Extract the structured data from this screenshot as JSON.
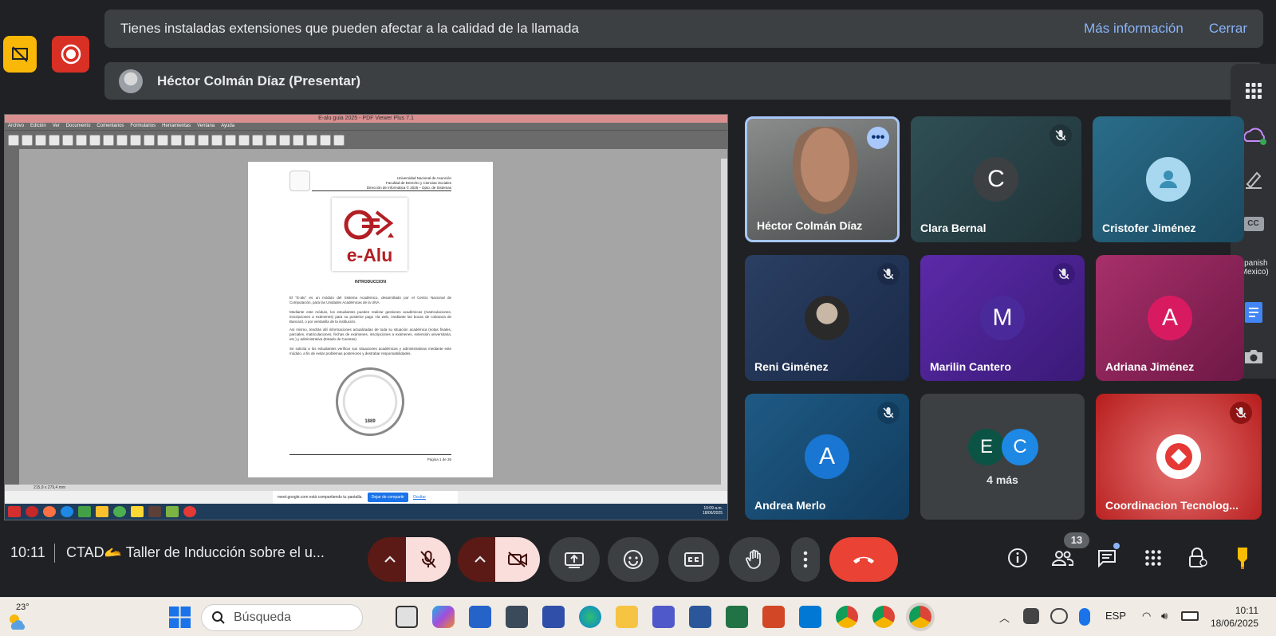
{
  "banner": {
    "message": "Tienes instaladas extensiones que pueden afectar a la calidad de la llamada",
    "more_info": "Más información",
    "close": "Cerrar"
  },
  "presenter": {
    "label": "Héctor Colmán Díaz (Presentar)"
  },
  "side_panel": {
    "caption_lang": "Spanish (Mexico)",
    "cc_label": "CC"
  },
  "pdf_viewer": {
    "title": "E-alu guia 2025 - PDF Viewer Plus 7.1",
    "menu": [
      "Archivo",
      "Edición",
      "Ver",
      "Documento",
      "Comentarios",
      "Formularios",
      "Herramientas",
      "Ventana",
      "Ayuda"
    ],
    "header_lines": [
      "Universidad Nacional de Asunción",
      "Facultad de Derecho y Ciencias Sociales",
      "Dirección de Informática © 2025 – Dpto. de Sistemas"
    ],
    "logo_text": "e-Alu",
    "heading": "INTRODUCCION",
    "para1": "El \"E-alu\" es un módulo del Sistema Académico, desarrollado por el Centro Nacional de Computación, para las Unidades Académicas de la UNA.",
    "para2": "Mediante este módulo, los estudiantes pueden realizar gestiones académicas (matriculaciones, inscripciones a exámenes) para su posterior pago vía web, mediante las bocas de cobranza de Bancard, o por ventanilla de la institución.",
    "para3": "Así mismo, tendrán allí informaciones actualizadas de toda su situación académica (notas finales, parciales, matriculaciones, fechas de exámenes, inscripciones a exámenes, extensión universitaria, etc.) y administrativa (Estado de Cuentas).",
    "para4": "Se solicita a los estudiantes verificar sus situaciones académicas y administrativas mediante este módulo, a fin de evitar problemas posteriores y destrabar responsabilidades.",
    "seal_year": "1889",
    "page_footer": "Página 1 de 36",
    "status_size": "215,9 x 279,4 mm",
    "share_text": "meet.google.com está compartiendo tu pantalla.",
    "share_stop": "Dejar de compartir",
    "share_hide": "Ocultar",
    "clock_time": "10:09 a.m.",
    "clock_date": "18/06/2025"
  },
  "participants": [
    {
      "name": "Héctor Colmán Díaz",
      "initial": "",
      "color": "#5f6368"
    },
    {
      "name": "Clara Bernal",
      "initial": "C",
      "color": "#3c4043"
    },
    {
      "name": "Cristofer Jiménez",
      "initial": "",
      "color": "#2a7fb0"
    },
    {
      "name": "Reni Giménez",
      "initial": "",
      "color": "#1e3a5f"
    },
    {
      "name": "Marilin Cantero",
      "initial": "M",
      "color": "#4a2a9a"
    },
    {
      "name": "Adriana Jiménez",
      "initial": "A",
      "color": "#c2185b"
    },
    {
      "name": "Andrea Merlo",
      "initial": "A",
      "color": "#1976d2"
    },
    {
      "name": "4 más",
      "initial": "",
      "color": "#3c4043"
    },
    {
      "name": "Coordinacion Tecnolog...",
      "initial": "",
      "color": "#c62828"
    }
  ],
  "more_group": {
    "a": "E",
    "b": "C"
  },
  "controls": {
    "time": "10:11",
    "meeting_title": "CTAD🫴 Taller de Inducción sobre el u...",
    "people_count": "13"
  },
  "taskbar": {
    "temperature": "23°",
    "search_placeholder": "Búsqueda",
    "lang": "ESP",
    "time": "10:11",
    "date": "18/06/2025"
  }
}
